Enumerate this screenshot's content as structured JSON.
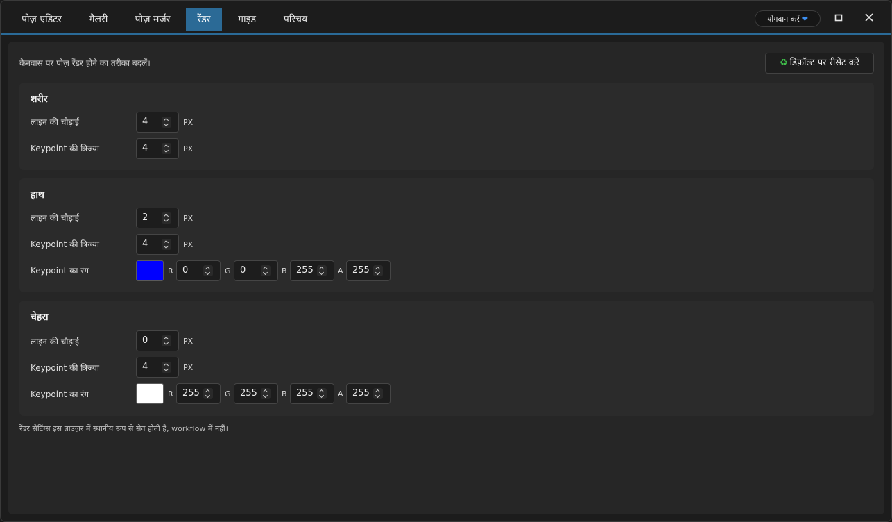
{
  "tabs": [
    {
      "label": "पोज़ एडिटर",
      "active": false
    },
    {
      "label": "गैलरी",
      "active": false
    },
    {
      "label": "पोज़ मर्जर",
      "active": false
    },
    {
      "label": "रेंडर",
      "active": true
    },
    {
      "label": "गाइड",
      "active": false
    },
    {
      "label": "परिचय",
      "active": false
    }
  ],
  "header": {
    "contribute_label": "योगदान करें",
    "heart_icon": "heart-icon",
    "maximize_icon": "maximize-icon",
    "close_icon": "close-icon"
  },
  "main": {
    "description": "कैनवास पर पोज़ रेंडर होने का तरीका बदलें।",
    "reset_label": "डिफ़ॉल्ट पर रीसेट करें",
    "reset_icon": "recycle-icon",
    "footer_note": "रेंडर सेटिंग्स इस ब्राउज़र में स्थानीय रूप से सेव होती हैं, workflow में नहीं।"
  },
  "body_section": {
    "title": "शरीर",
    "line_width_label": "लाइन की चौड़ाई",
    "line_width": "4",
    "radius_label": "Keypoint की त्रिज्या",
    "radius": "4",
    "unit": "PX"
  },
  "hand_section": {
    "title": "हाथ",
    "line_width_label": "लाइन की चौड़ाई",
    "line_width": "2",
    "radius_label": "Keypoint की त्रिज्या",
    "radius": "4",
    "unit": "PX",
    "color_label": "Keypoint का रंग",
    "color_hex": "#0000ff",
    "r_label": "R",
    "r": "0",
    "g_label": "G",
    "g": "0",
    "b_label": "B",
    "b": "255",
    "a_label": "A",
    "a": "255"
  },
  "face_section": {
    "title": "चेहरा",
    "line_width_label": "लाइन की चौड़ाई",
    "line_width": "0",
    "radius_label": "Keypoint की त्रिज्या",
    "radius": "4",
    "unit": "PX",
    "color_label": "Keypoint का रंग",
    "color_hex": "#ffffff",
    "r_label": "R",
    "r": "255",
    "g_label": "G",
    "g": "255",
    "b_label": "B",
    "b": "255",
    "a_label": "A",
    "a": "255"
  }
}
